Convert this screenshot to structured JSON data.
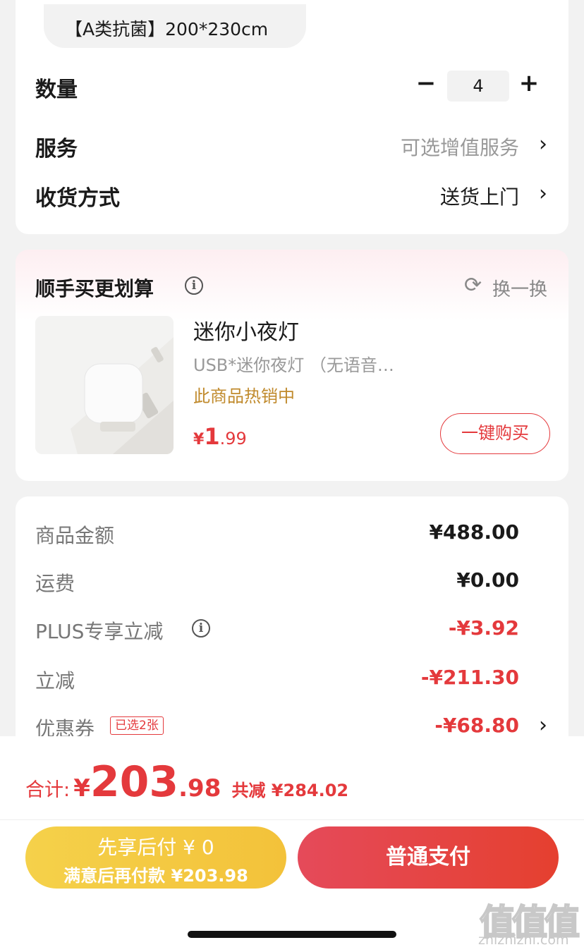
{
  "spec": {
    "selected": "【A类抗菌】200*230cm"
  },
  "quantity": {
    "label": "数量",
    "value": "4",
    "minus": "−",
    "plus": "+"
  },
  "service": {
    "label": "服务",
    "value": "可选增值服务"
  },
  "delivery": {
    "label": "收货方式",
    "value": "送货上门"
  },
  "chevron": "›",
  "bundle": {
    "title": "顺手买更划算",
    "info": "i",
    "refresh_icon": "⟳",
    "refresh_label": "换一换",
    "product": {
      "name": "迷你小夜灯",
      "desc": "USB*迷你夜灯 （无语音…",
      "hot": "此商品热销中",
      "price_symbol": "¥",
      "price_int": "1",
      "price_dec": ".99",
      "buy_label": "一键购买"
    }
  },
  "summary": {
    "rows": [
      {
        "label": "商品金额",
        "value": "¥488.00"
      },
      {
        "label": "运费",
        "value": "¥0.00"
      },
      {
        "label": "PLUS专享立减",
        "value": "-¥3.92"
      },
      {
        "label": "立减",
        "value": "-¥211.30"
      },
      {
        "label": "优惠券",
        "value": "-¥68.80",
        "badge": "已选2张"
      }
    ]
  },
  "total": {
    "label": "合计:",
    "symbol": "¥",
    "int": "203",
    "dec": ".98",
    "saved": "共减 ¥284.02"
  },
  "actions": {
    "pay_later_top": "先享后付 ¥ 0",
    "pay_later_bottom": "满意后再付款 ¥203.98",
    "pay_normal": "普通支付"
  },
  "watermark": {
    "logo": "值值值",
    "url": "zhizhizhi.com"
  },
  "colors": {
    "accent": "#e4393c",
    "gold": "#c08a2c",
    "yellow": "#f5c842"
  }
}
